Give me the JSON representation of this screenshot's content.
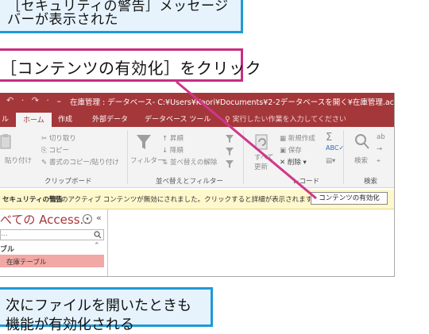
{
  "callouts": {
    "top_line1": "［セキュリティの警告］メッセージ",
    "top_line2": "バーが表示された",
    "mid": "［コンテンツの有効化］をクリック",
    "bottom_line1": "次にファイルを開いたときも",
    "bottom_line2": "機能が有効化される"
  },
  "window": {
    "title": "在庫管理 : データベース- C:¥Users¥Kaori¥Documents¥2-2データベースを開く¥在庫管理.accdb (Acce",
    "qat": "↶ · ↷ · ₌",
    "accent_color": "#a4373a"
  },
  "tabs": [
    "ル",
    "ホーム",
    "作成",
    "外部データ",
    "データベース ツール"
  ],
  "tell_me": "♀ 実行したい作業を入力してください",
  "ribbon": {
    "clipboard": {
      "cut": "切り取り",
      "copy": "コピー",
      "paste": "貼り付け",
      "format_painter": "書式のコピー/貼り付け",
      "label": "クリップボード"
    },
    "sort_filter": {
      "filter": "フィルター",
      "ascending": "昇順",
      "descending": "降順",
      "remove_sort": "並べ替えの解除",
      "label": "並べ替えとフィルター"
    },
    "records": {
      "new": "新規作成",
      "save": "保存",
      "delete": "削除",
      "refresh_line1": "すべて",
      "refresh_line2": "更新",
      "label": "レコード"
    },
    "find": {
      "search": "検索",
      "label": "検索"
    }
  },
  "security_bar": {
    "title": "セキュリティの警告",
    "message": "一部のアクティブ コンテンツが無効にされました。クリックすると詳細が表示されます。",
    "button": "コンテンツの有効化"
  },
  "nav_pane": {
    "header": "べての Access...",
    "search_placeholder": "...",
    "section": "ブル",
    "item": "在庫テーブル"
  }
}
